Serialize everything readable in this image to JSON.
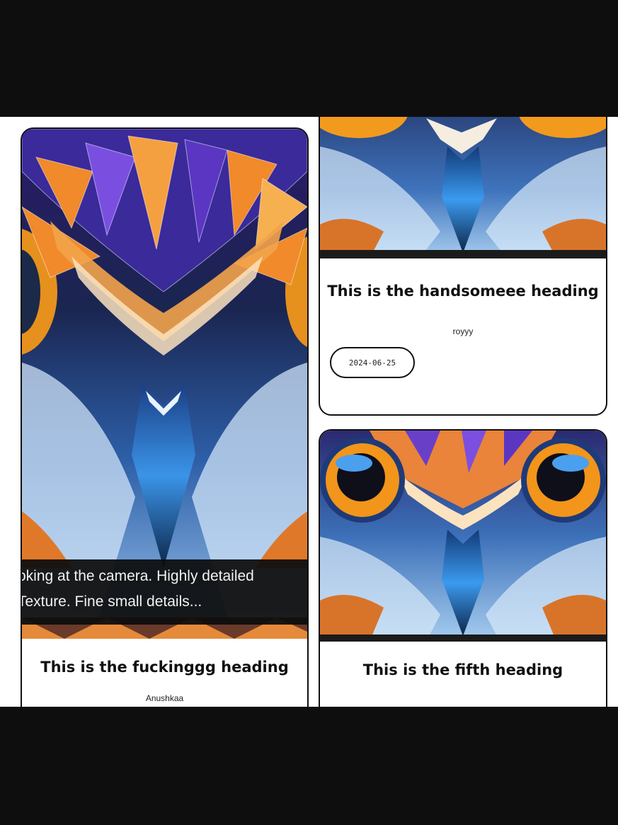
{
  "cards": [
    {
      "heading": "This is the fuckinggg heading",
      "author": "Anushkaa",
      "caption_lines": [
        "oking at the camera. Highly detailed",
        "Texture. Fine small details..."
      ],
      "image": "owl-feather-art"
    },
    {
      "heading": "This is the handsomeee heading",
      "author": "royyy",
      "date": "2024-06-25",
      "image": "owl-feather-art"
    },
    {
      "heading": "This is the fifth heading",
      "image": "owl-eyes-art"
    }
  ],
  "colors": {
    "orange_feather": "#f08a2a",
    "blue_feather": "#3a8ee0",
    "purple_feather": "#6a3fc8",
    "eye_amber": "#f39a1c",
    "ink": "#111111"
  }
}
